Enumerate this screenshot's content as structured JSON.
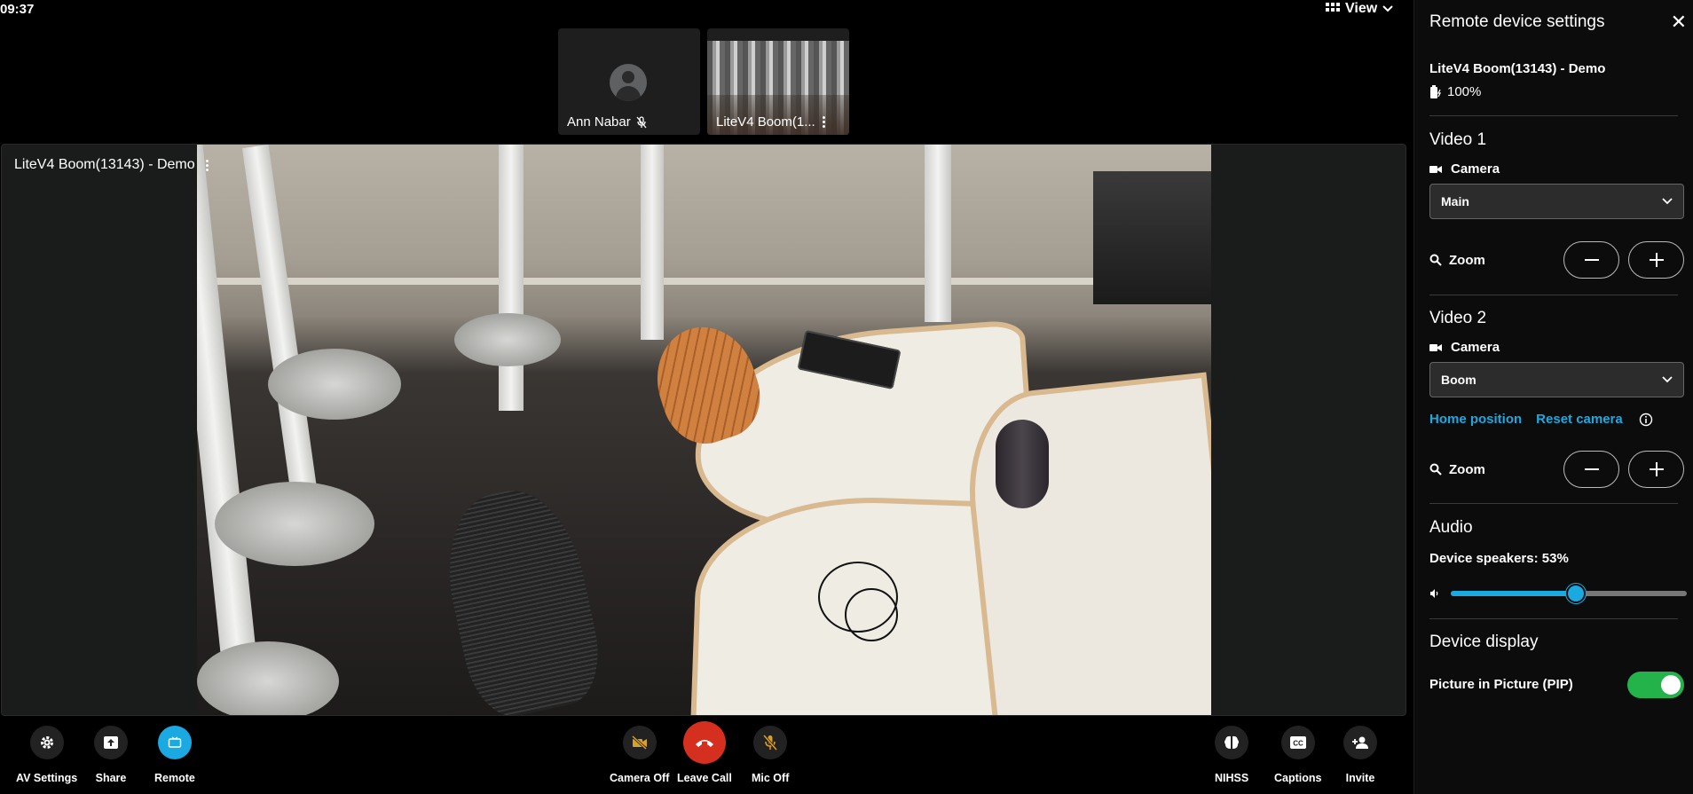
{
  "clock": "09:37",
  "view_menu": {
    "label": "View"
  },
  "thumbnails": [
    {
      "name": "Ann Nabar",
      "muted": true
    },
    {
      "name": "LiteV4 Boom(1..."
    }
  ],
  "main_video": {
    "label": "LiteV4 Boom(13143) - Demo"
  },
  "toolbar": {
    "left": [
      {
        "label": "AV Settings",
        "icon": "gear-icon"
      },
      {
        "label": "Share",
        "icon": "share-screen-icon"
      },
      {
        "label": "Remote",
        "icon": "remote-display-icon",
        "active": true
      }
    ],
    "center": [
      {
        "label": "Camera Off",
        "icon": "camera-off-icon"
      },
      {
        "label": "Leave Call",
        "icon": "hang-up-icon"
      },
      {
        "label": "Mic Off",
        "icon": "mic-off-icon"
      }
    ],
    "right": [
      {
        "label": "NIHSS",
        "icon": "brain-icon"
      },
      {
        "label": "Captions",
        "icon": "captions-icon"
      },
      {
        "label": "Invite",
        "icon": "add-person-icon"
      }
    ]
  },
  "panel": {
    "title": "Remote device settings",
    "device_name": "LiteV4 Boom(13143) - Demo",
    "battery": "100%",
    "video1": {
      "title": "Video 1",
      "camera_label": "Camera",
      "camera_value": "Main",
      "zoom_label": "Zoom"
    },
    "video2": {
      "title": "Video 2",
      "camera_label": "Camera",
      "camera_value": "Boom",
      "home_position": "Home position",
      "reset_camera": "Reset camera",
      "zoom_label": "Zoom"
    },
    "audio": {
      "title": "Audio",
      "speakers_label": "Device speakers: 53%",
      "speakers_level": 53
    },
    "display": {
      "title": "Device display",
      "pip_label": "Picture in Picture (PIP)",
      "pip_on": true
    }
  },
  "colors": {
    "accent": "#1aa9e0",
    "leave_call": "#d52f1f",
    "toggle_on": "#24b24b"
  }
}
